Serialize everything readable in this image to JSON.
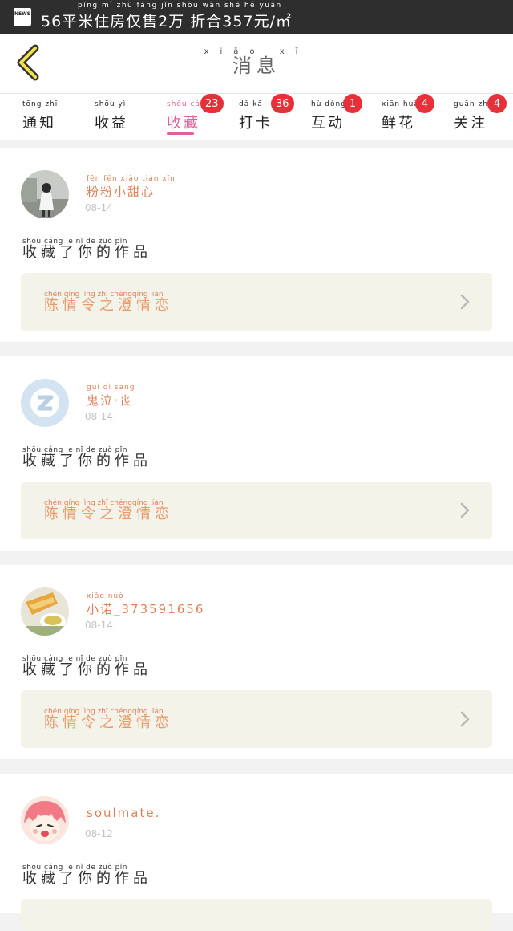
{
  "status_bar": {
    "app_icon": "NEWS",
    "headline": "56平米住房仅售2万 折合357元/㎡",
    "headline_pinyin": "píng mǐ zhù fáng jǐn shòu wàn shé hé yuán"
  },
  "header": {
    "back_icon": "chevron-left-icon",
    "title": "消息",
    "title_pinyin": "xiāo xī"
  },
  "tabs": [
    {
      "label": "通知",
      "pinyin": "tōng zhī",
      "badge": ""
    },
    {
      "label": "收益",
      "pinyin": "shōu yì",
      "badge": ""
    },
    {
      "label": "收藏",
      "pinyin": "shōu cáng",
      "badge": "23",
      "active": true
    },
    {
      "label": "打卡",
      "pinyin": "dǎ kǎ",
      "badge": "36"
    },
    {
      "label": "互动",
      "pinyin": "hù dòng",
      "badge": "1"
    },
    {
      "label": "鲜花",
      "pinyin": "xiān huā",
      "badge": "4"
    },
    {
      "label": "关注",
      "pinyin": "guān zhù",
      "badge": "4"
    }
  ],
  "colors": {
    "accent": "#e0609a",
    "badge": "#e8303a",
    "name": "#e07f57",
    "work_bg": "#f3f3ea"
  },
  "messages": [
    {
      "user": "粉粉小甜心",
      "user_pinyin": "fěn fěn xiǎo tián xīn",
      "date": "08-14",
      "action": "收藏了你的作品",
      "action_pinyin": "shōu cáng le nǐ de zuò pǐn",
      "work": "陈情令之澄情恋",
      "work_pinyin": "chén qíng lìng zhī chéngqíng liàn"
    },
    {
      "user": "鬼泣·丧",
      "user_pinyin": "guǐ qì sāng",
      "date": "08-14",
      "action": "收藏了你的作品",
      "action_pinyin": "shōu cáng le nǐ de zuò pǐn",
      "work": "陈情令之澄情恋",
      "work_pinyin": "chén qíng lìng zhī chéngqíng liàn"
    },
    {
      "user": "小诺_373591656",
      "user_pinyin": "xiǎo nuò",
      "date": "08-14",
      "action": "收藏了你的作品",
      "action_pinyin": "shōu cáng le nǐ de zuò pǐn",
      "work": "陈情令之澄情恋",
      "work_pinyin": "chén qíng lìng zhī chéngqíng liàn"
    },
    {
      "user": "soulmate.",
      "user_pinyin": "",
      "date": "08-12",
      "action": "收藏了你的作品",
      "action_pinyin": "shōu cáng le nǐ de zuò pǐn",
      "work": "",
      "work_pinyin": ""
    }
  ]
}
